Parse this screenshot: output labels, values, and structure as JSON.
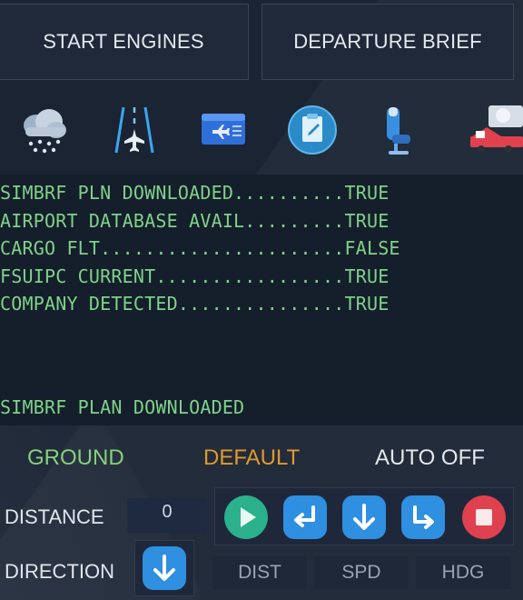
{
  "buttons": {
    "start_engines": "START ENGINES",
    "departure_brief": "DEPARTURE BRIEF"
  },
  "icons": [
    "weather-snow-cloud-icon",
    "runway-aircraft-icon",
    "boarding-pass-icon",
    "clipboard-icon",
    "passenger-seat-icon",
    "catering-truck-icon"
  ],
  "terminal": {
    "lines": [
      "SIMBRF PLN DOWNLOADED..........TRUE",
      "AIRPORT DATABASE AVAIL.........TRUE",
      "CARGO FLT......................FALSE",
      "FSUIPC CURRENT.................TRUE",
      "COMPANY DETECTED...............TRUE"
    ],
    "status_line": "SIMBRF PLAN DOWNLOADED"
  },
  "modes": {
    "ground": "GROUND",
    "default": "DEFAULT",
    "auto": "AUTO OFF"
  },
  "labels": {
    "distance": "DISTANCE",
    "direction": "DIRECTION"
  },
  "distance_value": "0",
  "tabs": [
    "DIST",
    "SPD",
    "HDG"
  ],
  "colors": {
    "ground": "#86d07c",
    "default": "#e09a2e",
    "terminal_text": "#7fd28a",
    "blue_button": "#2f8fe0",
    "green_button": "#2bb18c",
    "red_button": "#e0414e"
  }
}
